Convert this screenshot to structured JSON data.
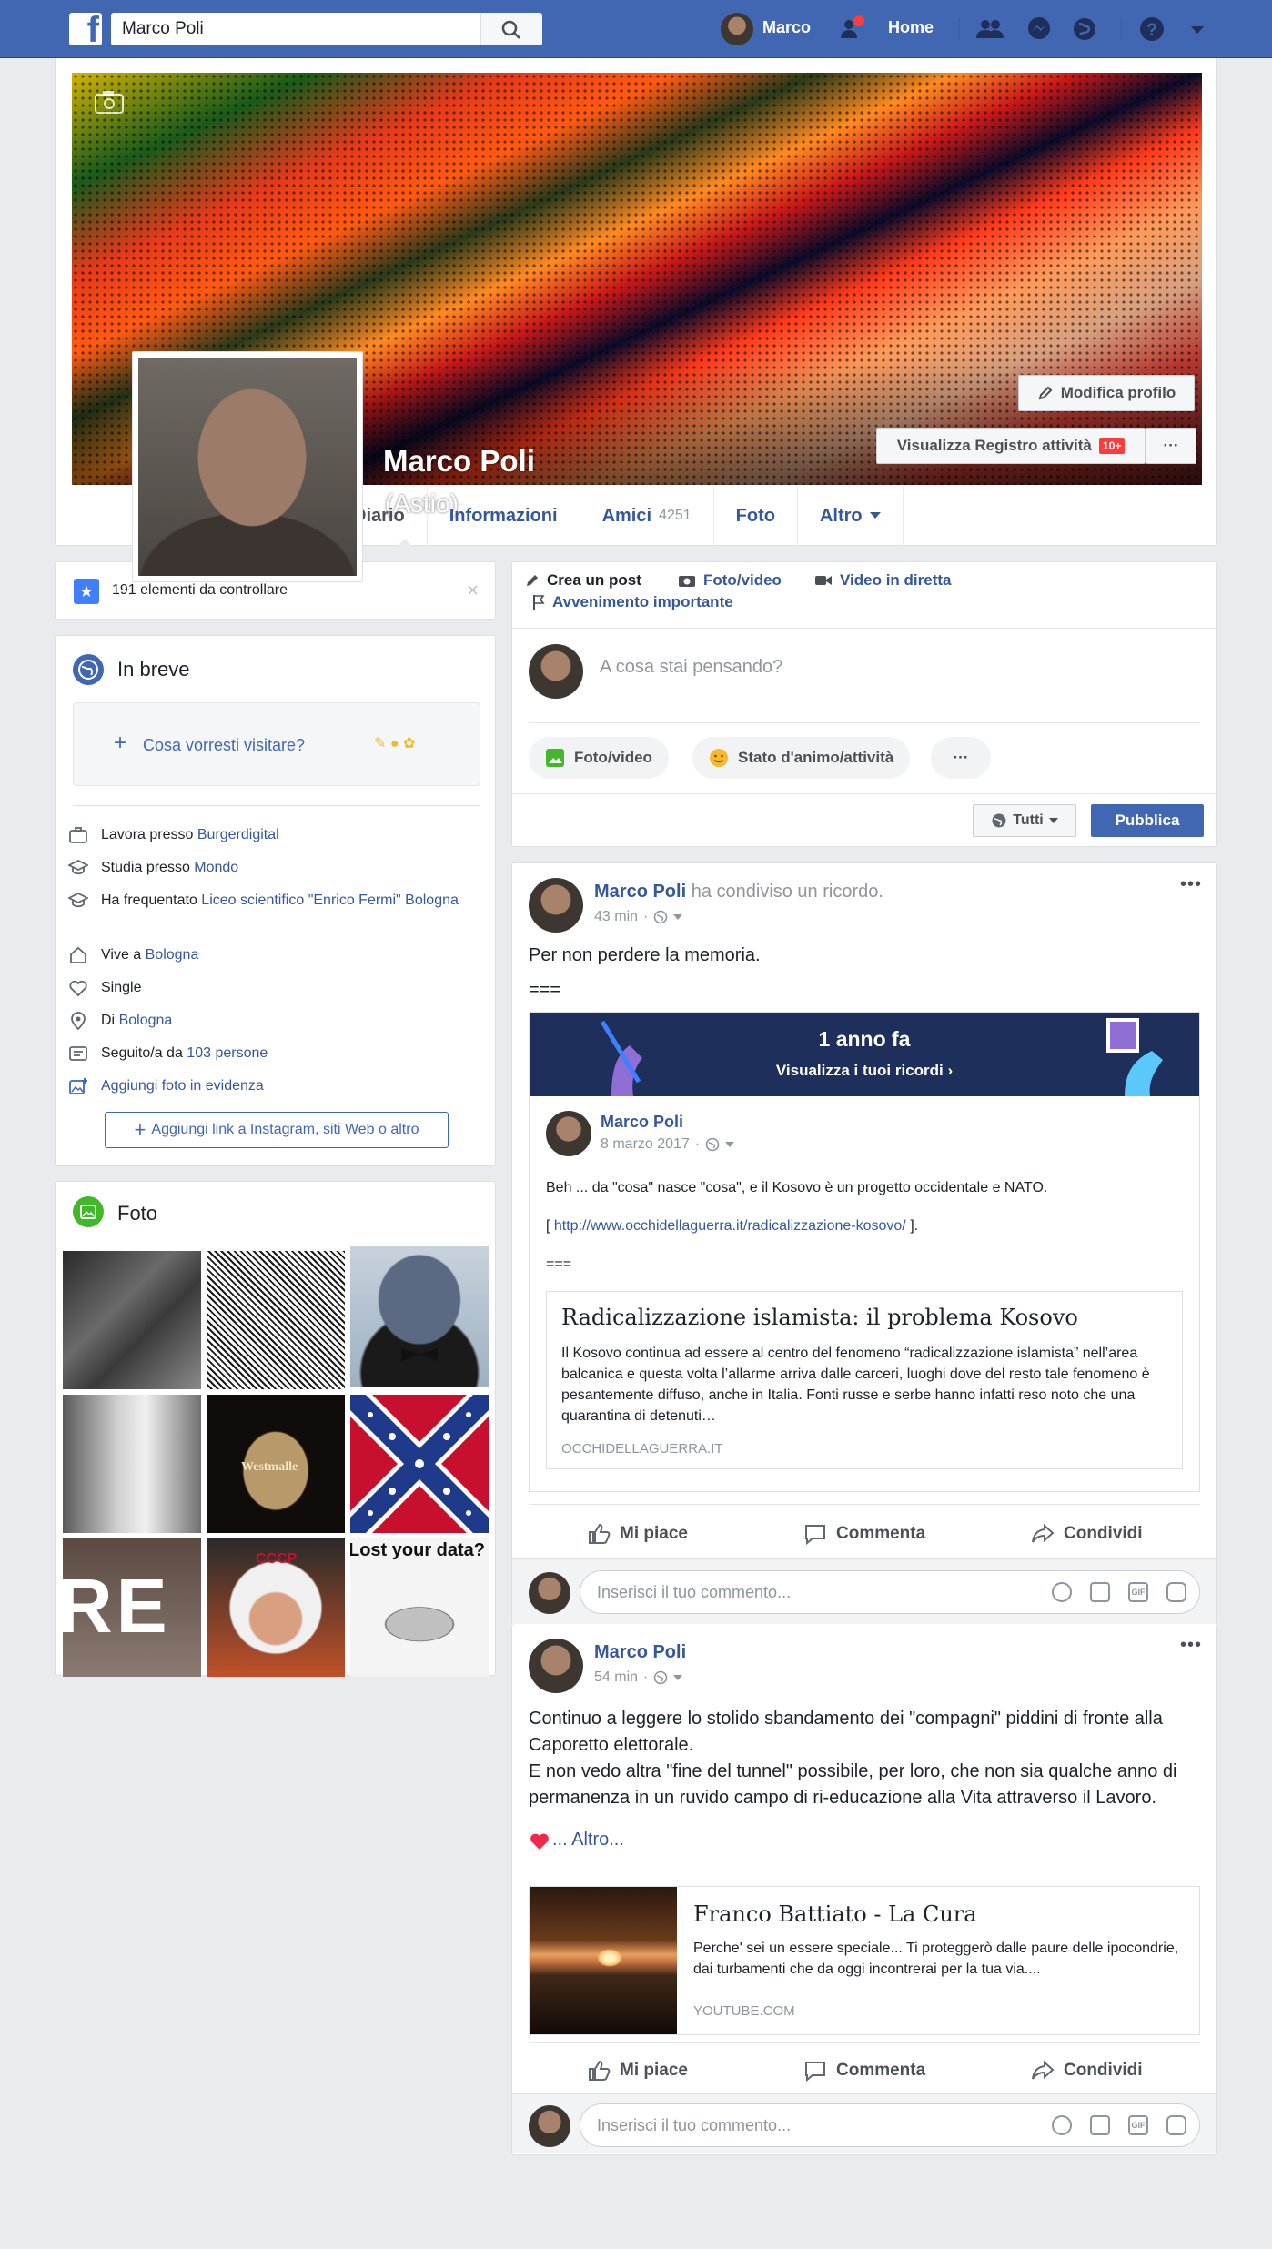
{
  "topbar": {
    "logo": "f",
    "search_value": "Marco Poli",
    "user_name": "Marco",
    "home": "Home",
    "friends_badge": ""
  },
  "profile": {
    "name": "Marco Poli",
    "alt_name": "(Astio)",
    "edit_button": "Modifica profilo",
    "activity_button": "Visualizza Registro attività",
    "activity_badge": "10+",
    "more": "···"
  },
  "tabs": {
    "diario": "Diario",
    "informazioni": "Informazioni",
    "amici": "Amici",
    "amici_count": "4251",
    "foto": "Foto",
    "altro": "Altro"
  },
  "review": {
    "text": "191 elementi da controllare",
    "close": "×"
  },
  "intro": {
    "title": "In breve",
    "bio_prompt": "Cosa vorresti visitare?",
    "rows": [
      {
        "prefix": "Lavora presso ",
        "link": "Burgerdigital"
      },
      {
        "prefix": "Studia presso ",
        "link": "Mondo"
      },
      {
        "prefix": "Ha frequentato ",
        "link": "Liceo scientifico \"Enrico Fermi\" Bologna"
      },
      {
        "prefix": "Vive a ",
        "link": "Bologna"
      },
      {
        "prefix": "Single",
        "link": ""
      },
      {
        "prefix": "Di ",
        "link": "Bologna"
      },
      {
        "prefix": "Seguito/a da ",
        "link": "103 persone"
      },
      {
        "prefix": "",
        "link": "Aggiungi foto in evidenza"
      }
    ],
    "add_link": "Aggiungi link a Instagram, siti Web o altro"
  },
  "photos": {
    "title": "Foto",
    "tile_text_re": "RE",
    "tile_text_westmalle": "Westmalle",
    "tile_text_cccp": "CCCP",
    "tile_text_data": "Lost your data?"
  },
  "composer": {
    "create_post": "Crea un post",
    "photo_video": "Foto/video",
    "live_video": "Video in diretta",
    "life_event": "Avvenimento importante",
    "placeholder": "A cosa stai pensando?",
    "btn_photo": "Foto/video",
    "btn_feeling": "Stato d'animo/attività",
    "btn_more": "···",
    "audience": "Tutti",
    "publish": "Pubblica"
  },
  "post1": {
    "author": "Marco Poli",
    "action": " ha condiviso un ricordo.",
    "time": "43 min",
    "text1": "Per non perdere la memoria.",
    "text2": "===",
    "memory_title": "1 anno fa",
    "memory_link": "Visualizza i tuoi ricordi ›",
    "inner_author": "Marco Poli",
    "inner_date": "8 marzo 2017",
    "inner_text1": "Beh ... da \"cosa\" nasce \"cosa\", e il Kosovo è un progetto occidentale e NATO.",
    "inner_text2_pre": "[ ",
    "inner_url": "http://www.occhidellaguerra.it/radicalizzazione-kosovo/",
    "inner_text2_post": " ].",
    "inner_text3": "===",
    "link_title": "Radicalizzazione islamista: il problema Kosovo",
    "link_desc": "Il Kosovo continua ad essere al centro del fenomeno “radicalizzazione islamista” nell’area balcanica e questa volta l’allarme arriva dalle carceri, luoghi dove del resto tale fenomeno è pesantemente diffuso, anche in Italia. Fonti russe e serbe hanno infatti reso noto che una quarantina di detenuti…",
    "link_domain": "OCCHIDELLAGUERRA.IT"
  },
  "post2": {
    "author": "Marco Poli",
    "time": "54 min",
    "text": "Continuo a leggere lo stolido sbandamento dei \"compagni\" piddini di fronte alla Caporetto elettorale.",
    "text2": "E non vedo altra \"fine del tunnel\" possibile, per loro, che non sia qualche anno di permanenza in un ruvido campo di ri-educazione alla Vita attraverso il Lavoro.",
    "more": "... Altro...",
    "link_title": "Franco Battiato - La Cura",
    "link_desc": "Perche' sei un essere speciale... Ti proteggerò dalle paure delle ipocondrie, dai turbamenti che da oggi incontrerai per la tua via....",
    "link_domain": "YOUTUBE.COM"
  },
  "actions": {
    "like": "Mi piace",
    "comment": "Commenta",
    "share": "Condividi",
    "comment_placeholder": "Inserisci il tuo commento...",
    "gif": "GIF"
  },
  "colors": {
    "brand": "#4267b2",
    "link": "#365899",
    "background": "#e9ebee",
    "badge": "#fa3e3e"
  }
}
